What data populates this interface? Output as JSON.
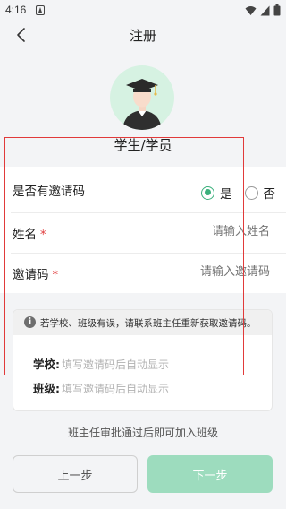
{
  "status_bar": {
    "time": "4:16"
  },
  "header": {
    "title": "注册"
  },
  "role": {
    "label": "学生/学员"
  },
  "form": {
    "invite_question": "是否有邀请码",
    "option_yes": "是",
    "option_no": "否",
    "selected": "是",
    "name_label": "姓名",
    "name_placeholder": "请输入姓名",
    "code_label": "邀请码",
    "code_placeholder": "请输入邀请码",
    "required_mark": "*"
  },
  "info": {
    "notice": "若学校、班级有误，请联系班主任重新获取邀请码。",
    "school_label": "学校:",
    "school_value": "填写邀请码后自动显示",
    "class_label": "班级:",
    "class_value": "填写邀请码后自动显示"
  },
  "approval_text": "班主任审批通过后即可加入班级",
  "buttons": {
    "prev": "上一步",
    "next": "下一步"
  },
  "colors": {
    "accent": "#3bb07c",
    "next_button": "#9ddcbe",
    "required": "#e0393a",
    "highlight": "#e13a3a"
  }
}
